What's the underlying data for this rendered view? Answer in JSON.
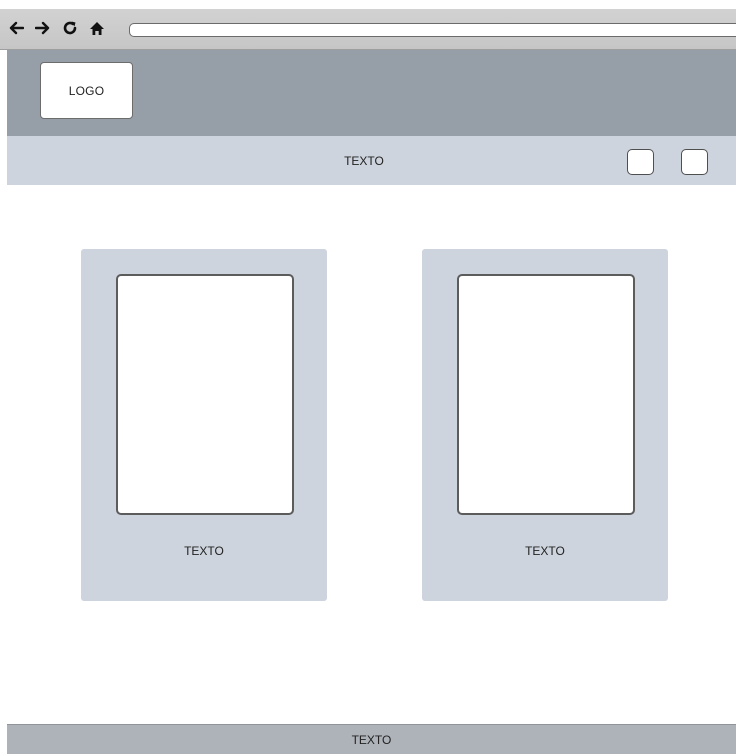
{
  "browser": {
    "back_icon": "arrow-left-icon",
    "forward_icon": "arrow-right-icon",
    "reload_icon": "reload-icon",
    "home_icon": "home-icon",
    "url": ""
  },
  "header": {
    "logo_label": "LOGO"
  },
  "subnav": {
    "text": "TEXTO"
  },
  "cards": [
    {
      "caption": "TEXTO"
    },
    {
      "caption": "TEXTO"
    }
  ],
  "footer": {
    "text": "TEXTO"
  },
  "colors": {
    "header_bg": "#969ea7",
    "subnav_bg": "#cdd4dd",
    "card_bg": "#cdd4dd",
    "footer_bg": "#adb3b9"
  }
}
